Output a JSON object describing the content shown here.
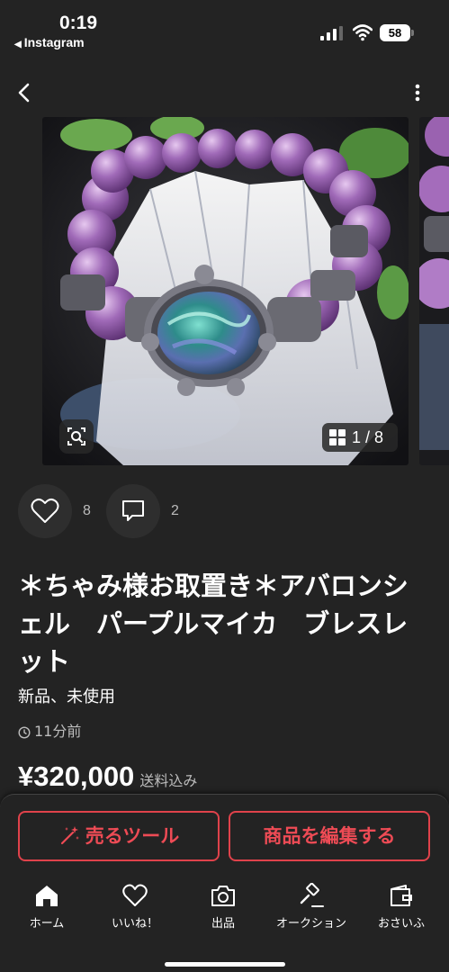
{
  "status_bar": {
    "time": "0:19",
    "back_app": "Instagram",
    "battery": "58"
  },
  "gallery": {
    "counter": "1 / 8"
  },
  "actions": {
    "likes": "8",
    "comments": "2"
  },
  "item": {
    "title": "＊ちゃみ様お取置き＊アバロンシェル　パープルマイカ　ブレスレット",
    "condition": "新品、未使用",
    "posted": "11分前",
    "price": "¥320,000",
    "shipping": "送料込み"
  },
  "cta": {
    "tools": "売るツール",
    "edit": "商品を編集する"
  },
  "tabs": [
    {
      "label": "ホーム",
      "icon": "home-icon"
    },
    {
      "label": "いいね！",
      "icon": "heart-icon"
    },
    {
      "label": "出品",
      "icon": "camera-icon"
    },
    {
      "label": "オークション",
      "icon": "gavel-icon"
    },
    {
      "label": "おさいふ",
      "icon": "wallet-icon"
    }
  ],
  "colors": {
    "accent": "#e0424b",
    "background": "#232323"
  }
}
